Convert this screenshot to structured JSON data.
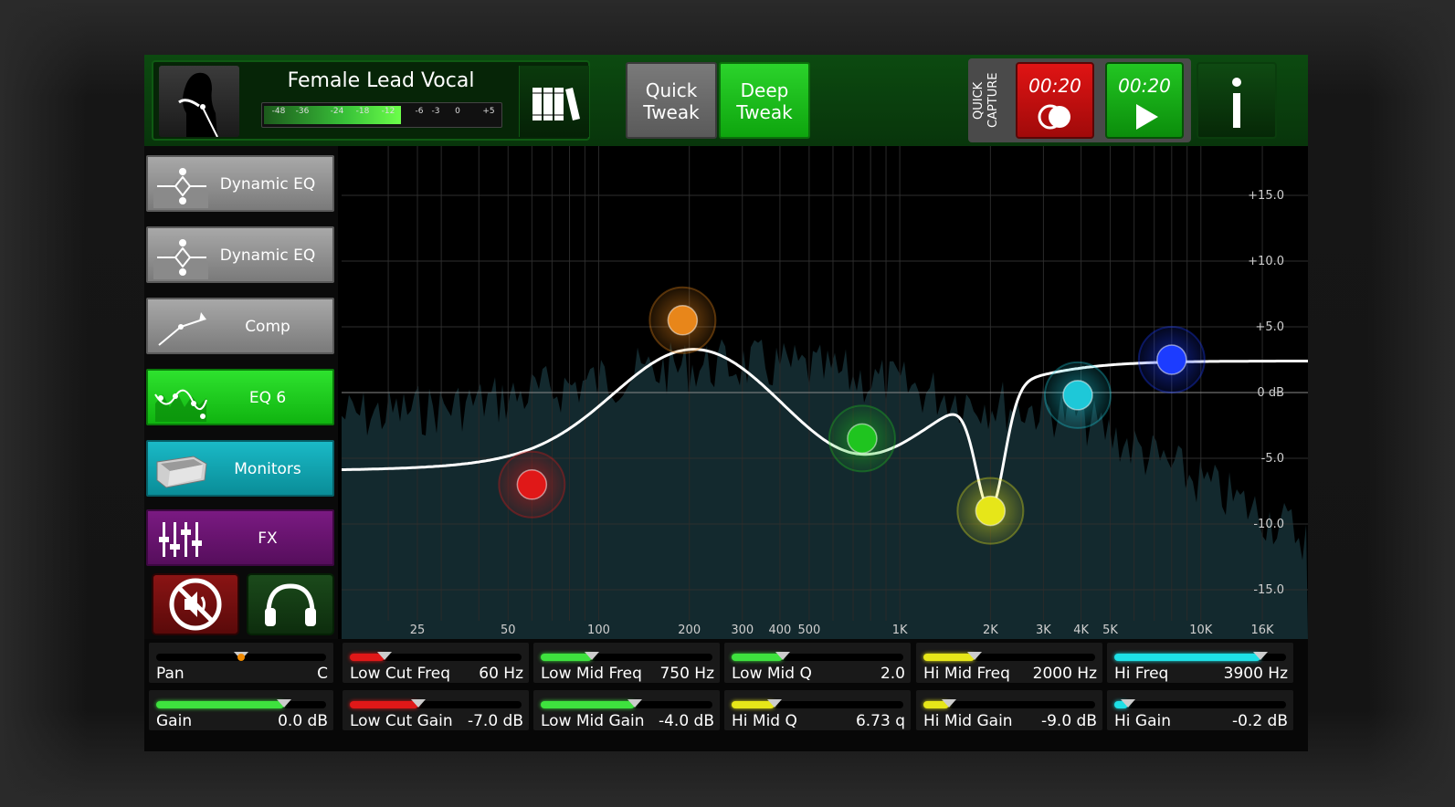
{
  "preset": {
    "title": "Female Lead Vocal",
    "meter_ticks": [
      "-48",
      "-36",
      "-24",
      "-18",
      "-12",
      "-6",
      "-3",
      "0",
      "+5"
    ],
    "meter_level_fraction": 0.58
  },
  "tweak": {
    "quick": "Quick Tweak",
    "deep": "Deep Tweak"
  },
  "quick_capture": {
    "label": "QUICK CAPTURE",
    "record_time": "00:20",
    "play_time": "00:20"
  },
  "sidebar": {
    "items": [
      {
        "label": "Dynamic EQ",
        "icon": "dynamic-eq-icon",
        "style": "gray"
      },
      {
        "label": "Dynamic EQ",
        "icon": "dynamic-eq-icon",
        "style": "gray"
      },
      {
        "label": "Comp",
        "icon": "compressor-icon",
        "style": "gray"
      },
      {
        "label": "EQ 6",
        "icon": "eq-curve-icon",
        "style": "green"
      },
      {
        "label": "Monitors",
        "icon": "monitor-wedge-icon",
        "style": "teal"
      },
      {
        "label": "FX",
        "icon": "fader-icon",
        "style": "purple"
      }
    ]
  },
  "eq": {
    "db_labels": [
      "+15.0",
      "+10.0",
      "+5.0",
      "0 dB",
      "-5.0",
      "-10.0",
      "-15.0"
    ],
    "freq_labels": [
      "25",
      "50",
      "100",
      "200",
      "300",
      "400",
      "500",
      "1K",
      "2K",
      "3K",
      "4K",
      "5K",
      "10K",
      "16K"
    ],
    "bands": [
      {
        "name": "low-cut",
        "freq_hz": 60,
        "gain_db": -7.0,
        "color": "#e01818"
      },
      {
        "name": "low-mid",
        "freq_hz": 190,
        "gain_db": 5.5,
        "color": "#e8861a"
      },
      {
        "name": "mid",
        "freq_hz": 750,
        "gain_db": -3.5,
        "color": "#1fc41f"
      },
      {
        "name": "hi-mid",
        "freq_hz": 2000,
        "gain_db": -9.0,
        "color": "#e6e619"
      },
      {
        "name": "hi",
        "freq_hz": 3900,
        "gain_db": -0.2,
        "color": "#1ec8d8"
      },
      {
        "name": "high",
        "freq_hz": 8000,
        "gain_db": 2.5,
        "color": "#1c3cff"
      }
    ]
  },
  "params": {
    "pan": {
      "name": "Pan",
      "value": "C",
      "fraction": 0.5,
      "color": "#f08a00"
    },
    "gain": {
      "name": "Gain",
      "value": "0.0 dB",
      "fraction": 0.75,
      "color": "#3ee23e"
    },
    "low_cut_freq": {
      "name": "Low Cut Freq",
      "value": "60 Hz",
      "fraction": 0.2,
      "color": "#e01818"
    },
    "low_cut_gain": {
      "name": "Low Cut Gain",
      "value": "-7.0 dB",
      "fraction": 0.4,
      "color": "#e01818"
    },
    "low_mid_freq": {
      "name": "Low Mid Freq",
      "value": "750 Hz",
      "fraction": 0.3,
      "color": "#3ee23e"
    },
    "low_mid_gain": {
      "name": "Low Mid Gain",
      "value": "-4.0 dB",
      "fraction": 0.55,
      "color": "#3ee23e"
    },
    "low_mid_q": {
      "name": "Low Mid Q",
      "value": "2.0",
      "fraction": 0.3,
      "color": "#3ee23e"
    },
    "hi_mid_q": {
      "name": "Hi Mid Q",
      "value": "6.73 q",
      "fraction": 0.25,
      "color": "#e6e619"
    },
    "hi_mid_freq": {
      "name": "Hi Mid Freq",
      "value": "2000 Hz",
      "fraction": 0.3,
      "color": "#e6e619"
    },
    "hi_mid_gain": {
      "name": "Hi Mid Gain",
      "value": "-9.0 dB",
      "fraction": 0.15,
      "color": "#e6e619"
    },
    "hi_freq": {
      "name": "Hi Freq",
      "value": "3900 Hz",
      "fraction": 0.85,
      "color": "#1ee0e6"
    },
    "hi_gain": {
      "name": "Hi Gain",
      "value": "-0.2 dB",
      "fraction": 0.08,
      "color": "#1ee0e6"
    }
  }
}
